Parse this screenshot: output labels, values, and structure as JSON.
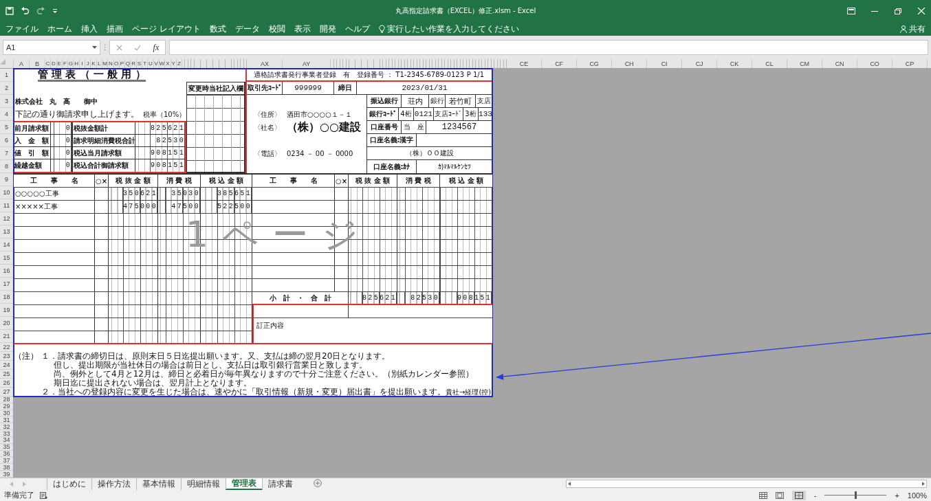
{
  "window": {
    "title": "丸高指定請求書（EXCEL）修正.xlsm  -  Excel"
  },
  "ribbon": {
    "tabs": [
      {
        "label": "ファイル",
        "selected": false
      },
      {
        "label": "ホーム",
        "selected": false
      },
      {
        "label": "挿入",
        "selected": false
      },
      {
        "label": "描画",
        "selected": false
      },
      {
        "label": "ページ レイアウト",
        "selected": false
      },
      {
        "label": "数式",
        "selected": false
      },
      {
        "label": "データ",
        "selected": false
      },
      {
        "label": "校閲",
        "selected": false
      },
      {
        "label": "表示",
        "selected": false
      },
      {
        "label": "開発",
        "selected": false
      },
      {
        "label": "ヘルプ",
        "selected": false
      }
    ],
    "tell_me": "実行したい作業を入力してください",
    "share": "共有"
  },
  "formula_bar": {
    "name_box": "A1",
    "function_label": "fx"
  },
  "column_headers": [
    {
      "label": "A",
      "kind": "medium"
    },
    {
      "label": "B",
      "kind": "medium"
    },
    {
      "label": "C",
      "kind": "narrow"
    },
    {
      "label": "D",
      "kind": "narrow"
    },
    {
      "label": "E",
      "kind": "narrow"
    },
    {
      "label": "F",
      "kind": "narrow"
    },
    {
      "label": "G",
      "kind": "narrow"
    },
    {
      "label": "H",
      "kind": "narrow"
    },
    {
      "label": "I",
      "kind": "narrow"
    },
    {
      "label": "J",
      "kind": "narrow"
    },
    {
      "label": "K",
      "kind": "narrow"
    },
    {
      "label": "L",
      "kind": "narrow"
    },
    {
      "label": "M",
      "kind": "narrow"
    },
    {
      "label": "N",
      "kind": "narrow"
    },
    {
      "label": "O",
      "kind": "narrow"
    },
    {
      "label": "P",
      "kind": "narrow"
    },
    {
      "label": "Q",
      "kind": "narrow"
    },
    {
      "label": "R",
      "kind": "narrow"
    },
    {
      "label": "S",
      "kind": "narrow"
    },
    {
      "label": "T",
      "kind": "narrow"
    },
    {
      "label": "U",
      "kind": "narrow"
    },
    {
      "label": "V",
      "kind": "narrow"
    },
    {
      "label": "W",
      "kind": "narrow"
    },
    {
      "label": "X",
      "kind": "narrow"
    },
    {
      "label": "Y",
      "kind": "narrow"
    },
    {
      "label": "Z",
      "kind": "narrow"
    },
    {
      "kind": "squeezed"
    },
    {
      "label": "AX",
      "kind": "wide"
    },
    {
      "label": "AY",
      "kind": "broad"
    },
    {
      "kind": "squeezed_long"
    },
    {
      "label": "CE",
      "kind": "wide"
    },
    {
      "label": "CF",
      "kind": "wide"
    },
    {
      "label": "CG",
      "kind": "wide"
    },
    {
      "label": "CH",
      "kind": "wide"
    },
    {
      "label": "CI",
      "kind": "wide"
    },
    {
      "label": "CJ",
      "kind": "wide"
    },
    {
      "label": "CK",
      "kind": "wide"
    },
    {
      "label": "CL",
      "kind": "wide"
    },
    {
      "label": "CM",
      "kind": "wide"
    },
    {
      "label": "CN",
      "kind": "wide"
    },
    {
      "label": "CO",
      "kind": "wide"
    },
    {
      "label": "CP",
      "kind": "wide"
    }
  ],
  "row_headers": [
    "1",
    "2",
    "3",
    "4",
    "5",
    "6",
    "7",
    "8",
    "9",
    "10",
    "11",
    "12",
    "13",
    "14",
    "15",
    "16",
    "17",
    "18",
    "19",
    "20",
    "21",
    "22",
    "23",
    "24",
    "25",
    "26",
    "27",
    "28",
    "29",
    "30",
    "31",
    "32",
    "33",
    "34",
    "35",
    "36",
    "37",
    "38",
    "39"
  ],
  "form": {
    "title": "管 理 表 （ 一 般 用 ）",
    "customer": "株式会社　丸　高　　御中",
    "greeting": "下記の通り御請求申し上げます。",
    "tax_rate": "税率（10%）",
    "summary": [
      {
        "label": "前月請求額",
        "value": "0",
        "total_label": "税抜金額計",
        "total": "825621"
      },
      {
        "label": "入　金　額",
        "value": "0",
        "total_label": "請求明細消費税合計",
        "total": "82530"
      },
      {
        "label": "値　引　額",
        "value": "0",
        "total_label": "税込当月請求額",
        "total": "908151"
      },
      {
        "label": "繰越金額",
        "value": "0",
        "total_label": "税込合計御請求額",
        "total": "908151"
      }
    ],
    "change_log_title": "変更時当社記入欄",
    "registration": "適格請求書発行事業者登録　有　登録番号 ： T1-2345-6789-0123",
    "page": "P 1/1",
    "supplier_code_label": "取引先ｺｰﾄﾞ",
    "supplier_code": "999999",
    "closing_label": "締日",
    "closing_date": "2023/01/31",
    "address_label": "〈住所〉",
    "address": "酒田市○○○○１－１",
    "company_label": "〈社名〉",
    "company": "（株）○○建設",
    "phone_label": "〈電話〉",
    "phone": "0234 － 00 － 0000",
    "bank": {
      "label": "振込銀行",
      "name": "荘内",
      "bank_suffix": "銀行",
      "branch": "若竹町",
      "branch_suffix": "支店",
      "code_label": "銀行ｺｰﾄﾞ",
      "code_digits": "4桁",
      "code": "0121",
      "branch_code_label": "支店ｺｰﾄﾞ",
      "branch_digits": "3桁",
      "branch_code": "133",
      "account_label": "口座番号",
      "account_type": "当　座",
      "account": "1234567",
      "holder_kanji_label": "口座名義:漢字",
      "holder_kanji": "（株）ＯＯ建設",
      "holder_kana_label": "口座名義:ｶﾅ",
      "holder_kana": "ｶ)ﾏﾙﾏﾙｹﾝｾﾂ"
    },
    "columns_left": [
      "工　　事　　名",
      "○×",
      "税 抜 金 額",
      "消 費 税",
      "税 込 金 額"
    ],
    "columns_right": [
      "工　　事　　名",
      "○×",
      "税 抜 金 額",
      "消 費 税",
      "税 込 金 額"
    ],
    "items": [
      {
        "name": "○○○○○工事",
        "net": "350621",
        "tax": "35030",
        "gross": "385651"
      },
      {
        "name": "×××××工事",
        "net": "475000",
        "tax": "47500",
        "gross": "522500"
      }
    ],
    "subtotal_label": "小　計　・　合　計",
    "subtotal": {
      "net": "825621",
      "tax": "82530",
      "gross": "908151"
    },
    "correction_label": "訂正内容",
    "page_number": "1ページ",
    "notes_label": "（注）",
    "notes": [
      {
        "kind": "item",
        "text": "１．請求書の締切日は、原則末日５日迄提出願います。又、支払は締の翌月20日となります。"
      },
      {
        "kind": "continuation",
        "text": "但し、提出期限が当社休日の場合は前日とし、支払日は取引銀行営業日と致します。"
      },
      {
        "kind": "continuation",
        "text": "尚、例外として4月と12月は、締日と必着日が毎年異なりますので十分ご注意ください。（別紙カレンダー参照）"
      },
      {
        "kind": "continuation",
        "text": "期日迄に提出されない場合は、翌月計上となります。"
      },
      {
        "kind": "item",
        "text": "２．当社への登録内容に変更を生じた場合は、速やかに「取引情報（新規・変更）届出書」を提出願います。"
      }
    ],
    "stamp": "貴社→経理(控)"
  },
  "sheet_tabs": [
    {
      "label": "はじめに",
      "selected": false
    },
    {
      "label": "操作方法",
      "selected": false
    },
    {
      "label": "基本情報",
      "selected": false
    },
    {
      "label": "明細情報",
      "selected": false
    },
    {
      "label": "管理表",
      "selected": true
    },
    {
      "label": "請求書",
      "selected": false
    }
  ],
  "status": {
    "text": "準備完了",
    "zoom_out": "-",
    "zoom_in": "+",
    "zoom_label": "100%",
    "zoom": {
      "level": 0.5
    }
  }
}
